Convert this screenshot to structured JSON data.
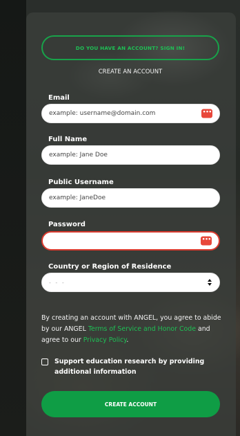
{
  "signin": {
    "label": "DO YOU HAVE AN ACCOUNT? SIGN IN!"
  },
  "form": {
    "heading": "CREATE AN ACCOUNT",
    "email": {
      "label": "Email",
      "placeholder": "example: username@domain.com"
    },
    "full_name": {
      "label": "Full Name",
      "placeholder": "example: Jane Doe"
    },
    "username": {
      "label": "Public Username",
      "placeholder": "example: JaneDoe"
    },
    "password": {
      "label": "Password",
      "value": ""
    },
    "country": {
      "label": "Country or Region of Residence",
      "selected": "- - -"
    }
  },
  "legal": {
    "part1": "By creating an account with ANGEL, you agree to abide by our ANGEL ",
    "terms_link": "Terms of Service and Honor Code",
    "part2": " and agree to our ",
    "privacy_link": "Privacy Policy",
    "part3": "."
  },
  "research": {
    "label": "Support education research by providing additional information",
    "checked": false
  },
  "submit": {
    "label": "CREATE ACCOUNT"
  },
  "icons": {
    "password_manager": "password-manager-icon",
    "select_arrows": "select-arrows-icon"
  },
  "colors": {
    "accent": "#0f9d45",
    "error": "#d93a2e",
    "panel": "#3a3e3a"
  }
}
